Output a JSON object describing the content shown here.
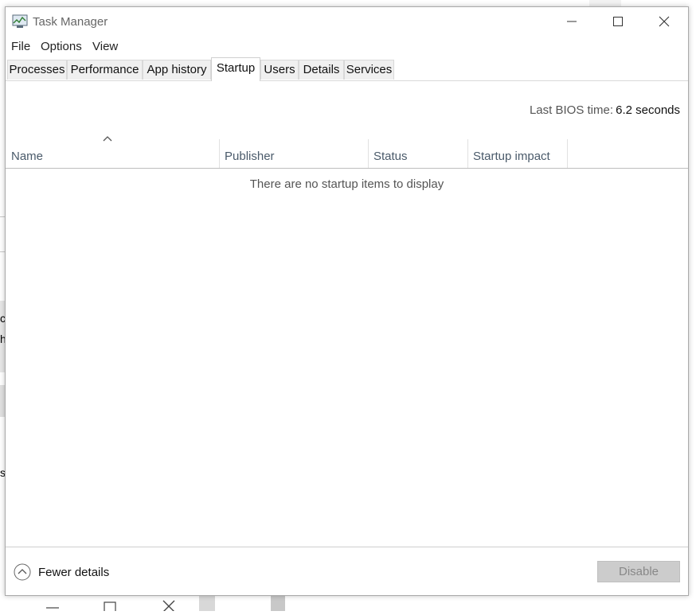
{
  "window": {
    "title": "Task Manager",
    "controls": {
      "minimize": "minimize-icon",
      "maximize": "maximize-icon",
      "close": "close-icon"
    }
  },
  "menu": {
    "items": [
      "File",
      "Options",
      "View"
    ]
  },
  "tabs": {
    "items": [
      "Processes",
      "Performance",
      "App history",
      "Startup",
      "Users",
      "Details",
      "Services"
    ],
    "active": "Startup"
  },
  "bios": {
    "label": "Last BIOS time:",
    "value": "6.2 seconds"
  },
  "table": {
    "columns": [
      "Name",
      "Publisher",
      "Status",
      "Startup impact"
    ],
    "sort_column": "Name",
    "empty_message": "There are no startup items to display"
  },
  "footer": {
    "fewer_details": "Fewer details",
    "disable": "Disable"
  },
  "background": {
    "glyph_1": "c",
    "glyph_2": "h",
    "glyph_3": "s"
  },
  "colors": {
    "header_text": "#4a5a6a",
    "disabled_button": "#cccccc"
  }
}
